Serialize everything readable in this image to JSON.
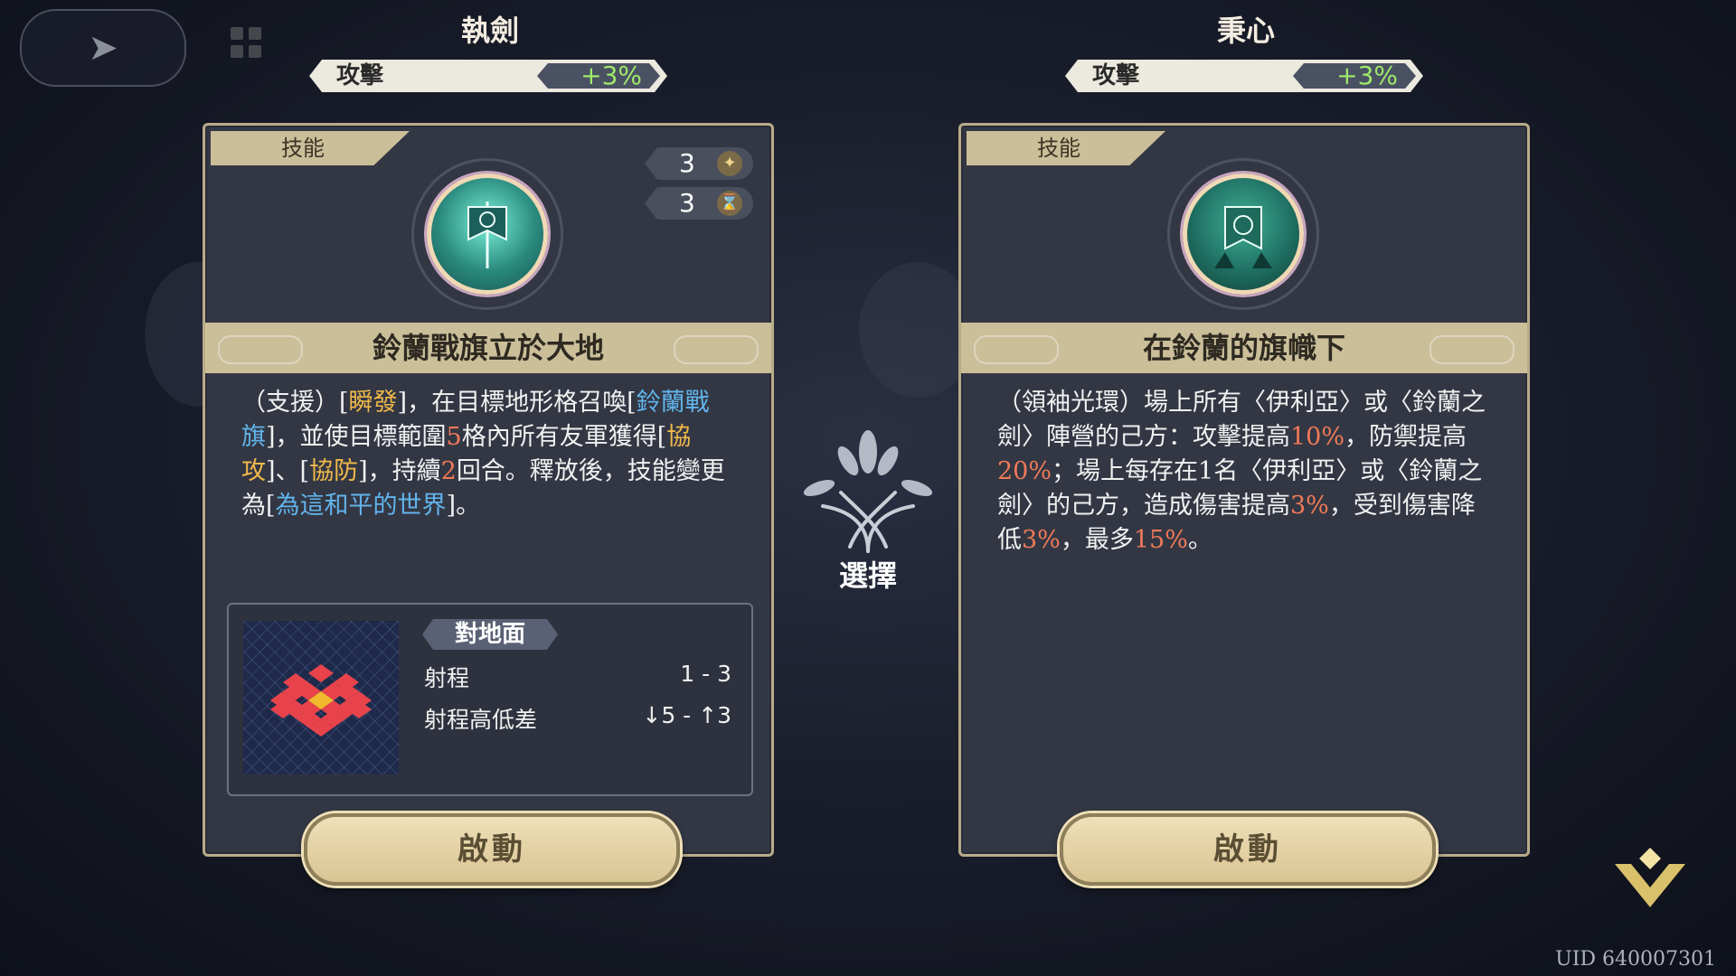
{
  "left": {
    "title": "執劍",
    "stat_label": "攻擊",
    "stat_value": "+3%",
    "tab_label": "技能",
    "cost_1": "3",
    "cost_2": "3",
    "skill_name": "鈴蘭戰旗立於大地",
    "desc": {
      "p1": "（支援）[",
      "h1": "瞬發",
      "p2": "]，在目標地形格召喚[",
      "h2": "鈴蘭戰旗",
      "p3": "]，並使目標範圍",
      "h3": "5",
      "p4": "格內所有友軍獲得[",
      "h4": "協攻",
      "p5": "]、[",
      "h5": "協防",
      "p6": "]，持續",
      "h6": "2",
      "p7": "回合。釋放後，技能變更為[",
      "h7": "為這和平的世界",
      "p8": "]。"
    },
    "terrain": "對地面",
    "range_label": "射程",
    "range_value": "1 - 3",
    "height_label": "射程高低差",
    "height_value": "↓5 - ↑3",
    "button": "啟動"
  },
  "right": {
    "title": "秉心",
    "stat_label": "攻擊",
    "stat_value": "+3%",
    "tab_label": "技能",
    "skill_name": "在鈴蘭的旗幟下",
    "desc": {
      "p1": "（領袖光環）場上所有〈伊利亞〉或〈鈴蘭之劍〉陣營的己方：攻擊提高",
      "h1": "10%",
      "p2": "，防禦提高",
      "h2": "20%",
      "p3": "；場上每存在1名〈伊利亞〉或〈鈴蘭之劍〉的己方，造成傷害提高",
      "h3": "3%",
      "p4": "，受到傷害降低",
      "h4": "3%",
      "p5": "，最多",
      "h5": "15%",
      "p6": "。"
    },
    "button": "啟動"
  },
  "center_label": "選擇",
  "uid": "UID 640007301",
  "colors": {
    "card_border": "#b8ab8a",
    "band": "#cbbf9a",
    "stat_green": "#9ee86a",
    "highlight_gold": "#f0b94a",
    "highlight_blue": "#62b4ec",
    "highlight_red": "#f07a58"
  },
  "icons": [
    "back-arrow-icon",
    "grid-menu-icon",
    "star-cost-icon",
    "hourglass-icon",
    "banner-skill-icon",
    "flag-skill-icon",
    "tree-emblem-icon",
    "chevron-down-icon"
  ]
}
